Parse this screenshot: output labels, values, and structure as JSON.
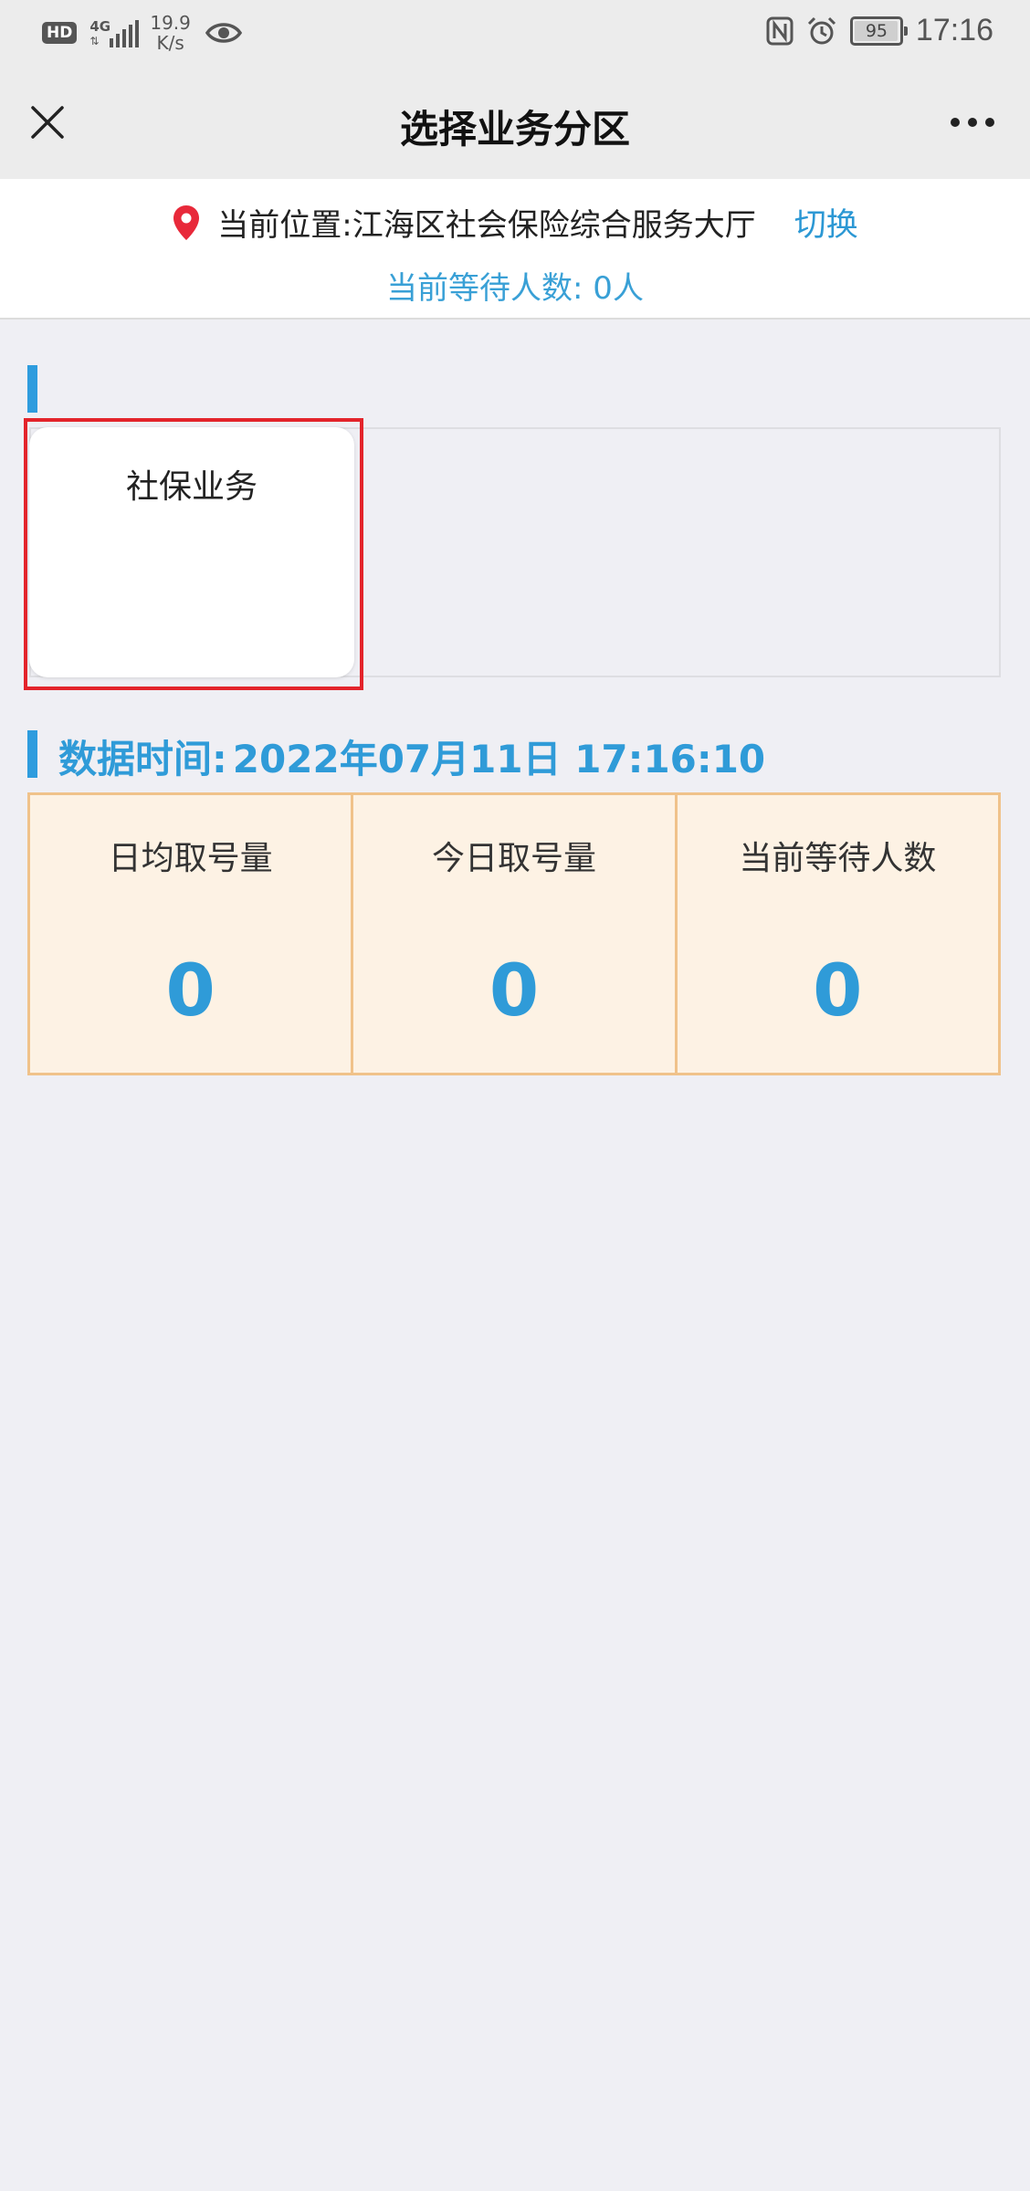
{
  "status_bar": {
    "hd": "HD",
    "network": "4G",
    "speed_value": "19.9",
    "speed_unit": "K/s",
    "battery": "95",
    "time": "17:16",
    "icons": [
      "eye-icon",
      "nfc-icon",
      "alarm-icon"
    ]
  },
  "header": {
    "title": "选择业务分区"
  },
  "location": {
    "label": "当前位置:",
    "value": "江海区社会保险综合服务大厅",
    "switch": "切换",
    "waiting": "当前等待人数: 0人",
    "pin_color": "#e8293a"
  },
  "zones": [
    {
      "name": "社保业务"
    }
  ],
  "data_time": {
    "label": "数据时间:",
    "value": "2022年07月11日 17:16:10"
  },
  "stats": [
    {
      "label": "日均取号量",
      "value": "0"
    },
    {
      "label": "今日取号量",
      "value": "0"
    },
    {
      "label": "当前等待人数",
      "value": "0"
    }
  ],
  "colors": {
    "accent": "#2f9bd8",
    "highlight": "#e3242b",
    "stats_bg": "#fdf2e4",
    "stats_border": "#f0c28a",
    "page_bg": "#efeff4"
  }
}
